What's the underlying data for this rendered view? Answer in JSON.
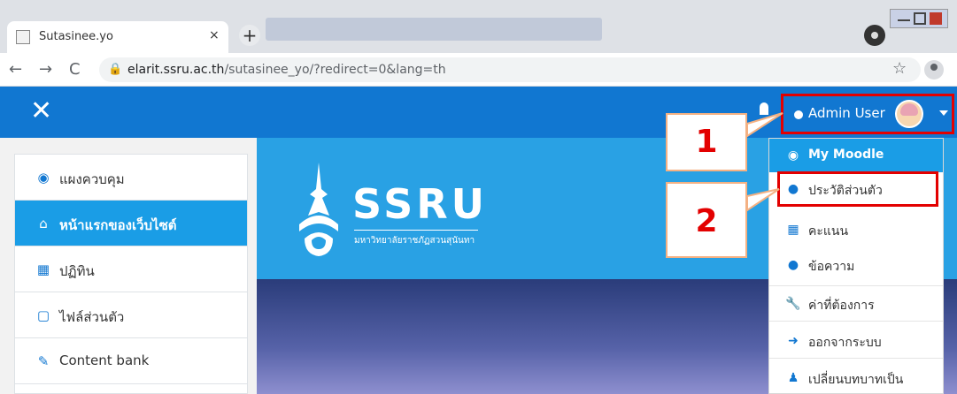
{
  "browser": {
    "tab_title": "Sutasinee.yo",
    "tab_close": "×",
    "new_tab": "+",
    "url_host": "elarit.ssru.ac.th",
    "url_path": "/sutasinee_yo/?redirect=0&lang=th",
    "back": "←",
    "forward": "→",
    "reload": "C",
    "star": "☆"
  },
  "navbar": {
    "close": "✕",
    "user_name": "Admin User"
  },
  "banner": {
    "logo_text": "SSRU",
    "logo_subtitle": "มหาวิทยาลัยราชภัฏสวนสุนันทา"
  },
  "sidebar": {
    "items": [
      {
        "label": "แผงควบคุม",
        "icon": "dashboard-icon",
        "active": false
      },
      {
        "label": "หน้าแรกของเว็บไซต์",
        "icon": "home-icon",
        "active": true
      },
      {
        "label": "ปฏิทิน",
        "icon": "calendar-icon",
        "active": false
      },
      {
        "label": "ไฟล์ส่วนตัว",
        "icon": "file-icon",
        "active": false
      },
      {
        "label": "Content bank",
        "icon": "paintbrush-icon",
        "active": false
      }
    ]
  },
  "user_menu": {
    "items": [
      {
        "label": "My Moodle",
        "icon": "dashboard-icon"
      },
      {
        "label": "ประวัติส่วนตัว",
        "icon": "user-icon"
      },
      {
        "label": "คะแนน",
        "icon": "table-icon"
      },
      {
        "label": "ข้อความ",
        "icon": "comment-icon"
      },
      {
        "label": "ค่าที่ต้องการ",
        "icon": "wrench-icon"
      },
      {
        "label": "ออกจากระบบ",
        "icon": "sign-out-icon"
      },
      {
        "label": "เปลี่ยนบทบาทเป็น",
        "icon": "user-secret-icon"
      }
    ]
  },
  "annotations": {
    "callout_1": "1",
    "callout_2": "2"
  },
  "colors": {
    "navbar": "#1177d1",
    "accent": "#1a9de6",
    "highlight": "#e30000",
    "callout_border": "#f4b183"
  }
}
